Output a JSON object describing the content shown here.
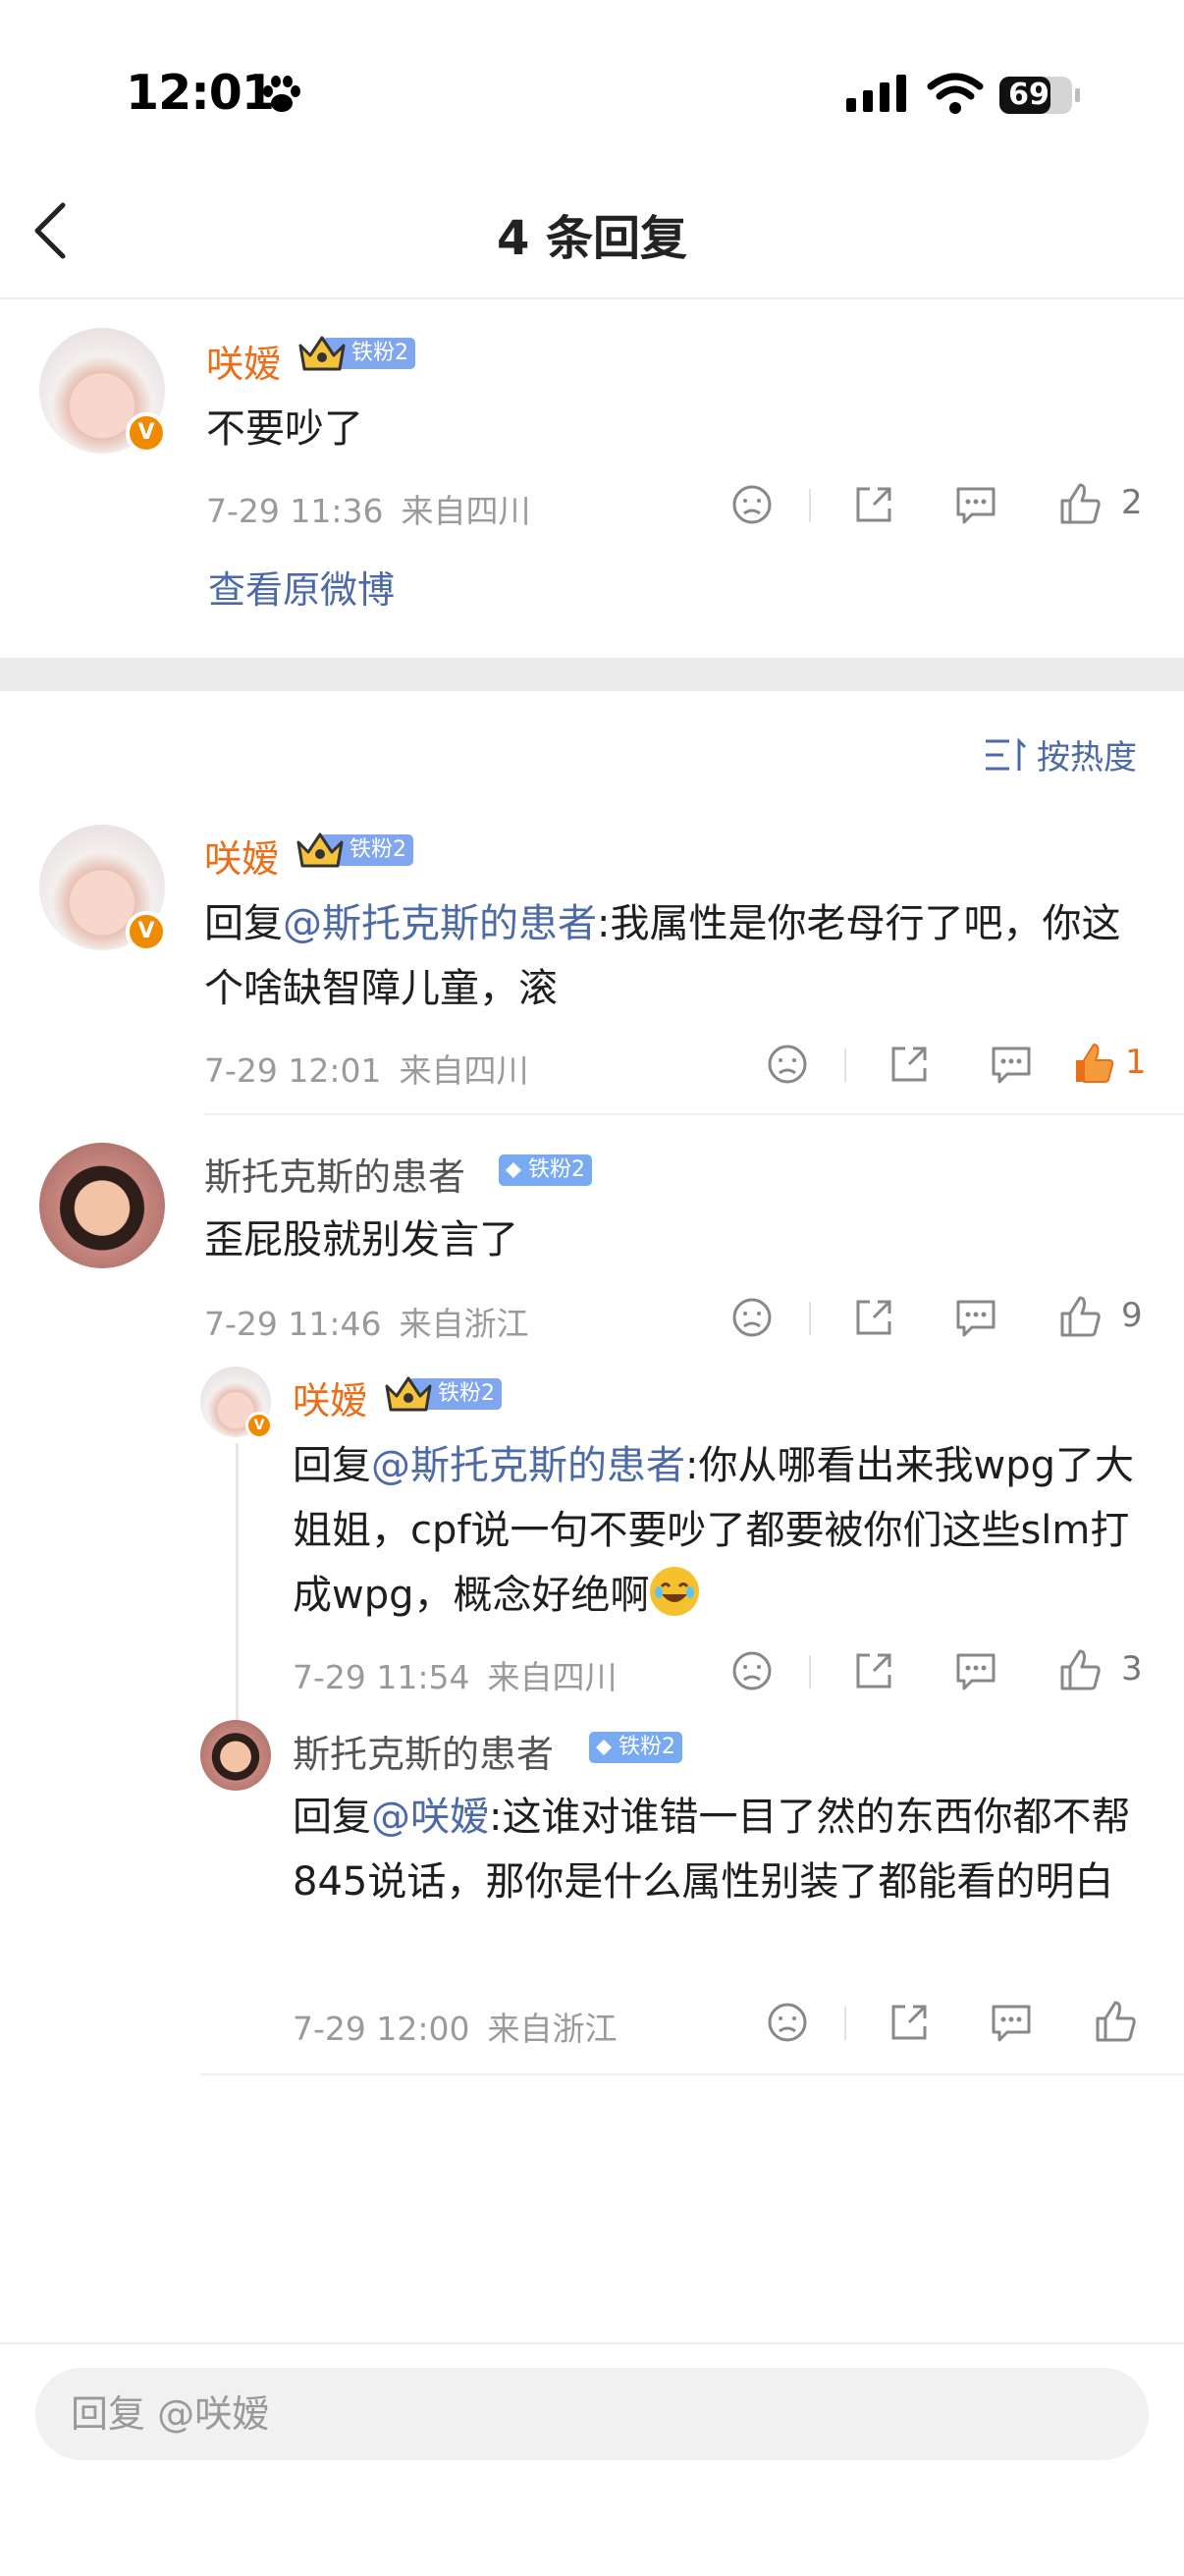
{
  "status_bar": {
    "time": "12:01",
    "battery": "69",
    "icons": [
      "paw-icon",
      "signal-icon",
      "wifi-icon",
      "battery-icon"
    ]
  },
  "header": {
    "title": "4 条回复",
    "back_icon": "chevron-left-icon"
  },
  "original_comment": {
    "author": "咲嫒",
    "fan_badge": "铁粉2",
    "text": "不要吵了",
    "time": "7-29 11:36",
    "location": "来自四川",
    "likes": "2",
    "view_original": "查看原微博"
  },
  "sort": {
    "label": "按热度"
  },
  "replies": [
    {
      "author": "咲嫒",
      "fan_badge": "铁粉2",
      "reply_prefix": "回复",
      "mention": "@斯托克斯的患者",
      "text": ":我属性是你老母行了吧，你这个啥缺智障儿童，滚",
      "time": "7-29 12:01",
      "location": "来自四川",
      "likes": "1",
      "liked": true
    },
    {
      "author": "斯托克斯的患者",
      "fan_badge": "铁粉2",
      "text": "歪屁股就别发言了",
      "time": "7-29 11:46",
      "location": "来自浙江",
      "likes": "9",
      "sub_replies": [
        {
          "author": "咲嫒",
          "fan_badge": "铁粉2",
          "reply_prefix": "回复",
          "mention": "@斯托克斯的患者",
          "text": ":你从哪看出来我wpg了大姐姐，cpf说一句不要吵了都要被你们这些slm打成wpg，概念好绝啊",
          "time": "7-29 11:54",
          "location": "来自四川",
          "likes": "3"
        },
        {
          "author": "斯托克斯的患者",
          "fan_badge": "铁粉2",
          "reply_prefix": "回复",
          "mention": "@咲嫒",
          "text": ":这谁对谁错一目了然的东西你都不帮845说话，那你是什么属性别装了都能看的明白",
          "time": "7-29 12:00",
          "location": "来自浙江",
          "likes": ""
        }
      ]
    }
  ],
  "footer": {
    "reply_placeholder": "回复 @咲嫒"
  },
  "colors": {
    "name_orange": "#ea6f1a",
    "link_blue": "#4d6aa8",
    "meta_gray": "#9a9a9a",
    "badge_blue": "#7fa6ee"
  }
}
